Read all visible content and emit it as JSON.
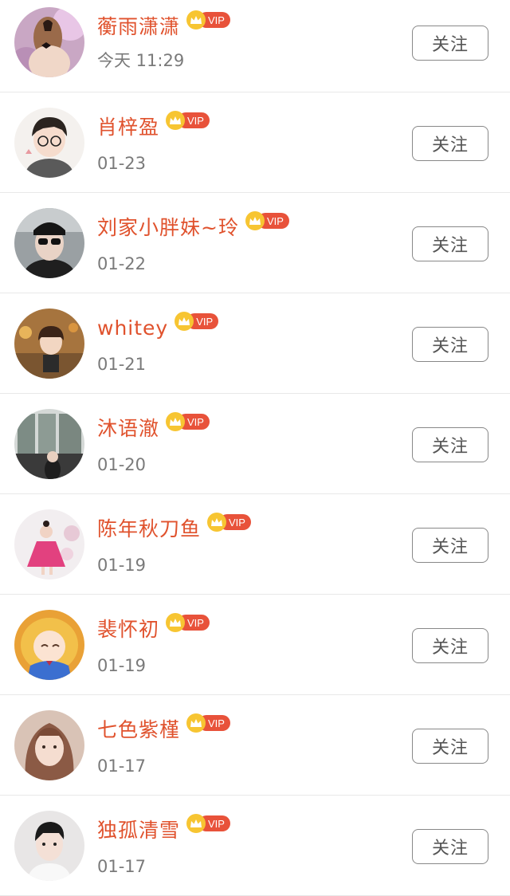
{
  "colors": {
    "name": "#e0522d",
    "vip_badge": "#e8523a",
    "crown": "#f7c532",
    "time_text": "#7a7a7a",
    "button_border": "#888888"
  },
  "vip_label": "VIP",
  "follow_label": "关注",
  "users": [
    {
      "name": "蘅雨潇潇",
      "time": "今天 11:29",
      "icon": "avatar-girl-back-icon"
    },
    {
      "name": "肖梓盈",
      "time": "01-23",
      "icon": "avatar-cartoon-boy-icon"
    },
    {
      "name": "刘家小胖妹~玲",
      "time": "01-22",
      "icon": "avatar-sunglasses-icon"
    },
    {
      "name": "whitey",
      "time": "01-21",
      "icon": "avatar-doll-icon"
    },
    {
      "name": "沐语澈",
      "time": "01-20",
      "icon": "avatar-window-icon"
    },
    {
      "name": "陈年秋刀鱼",
      "time": "01-19",
      "icon": "avatar-pink-dress-icon"
    },
    {
      "name": "裴怀初",
      "time": "01-19",
      "icon": "avatar-anime-girl-icon"
    },
    {
      "name": "七色紫槿",
      "time": "01-17",
      "icon": "avatar-portrait-girl-icon"
    },
    {
      "name": "独孤清雪",
      "time": "01-17",
      "icon": "avatar-portrait-boy-icon"
    }
  ]
}
